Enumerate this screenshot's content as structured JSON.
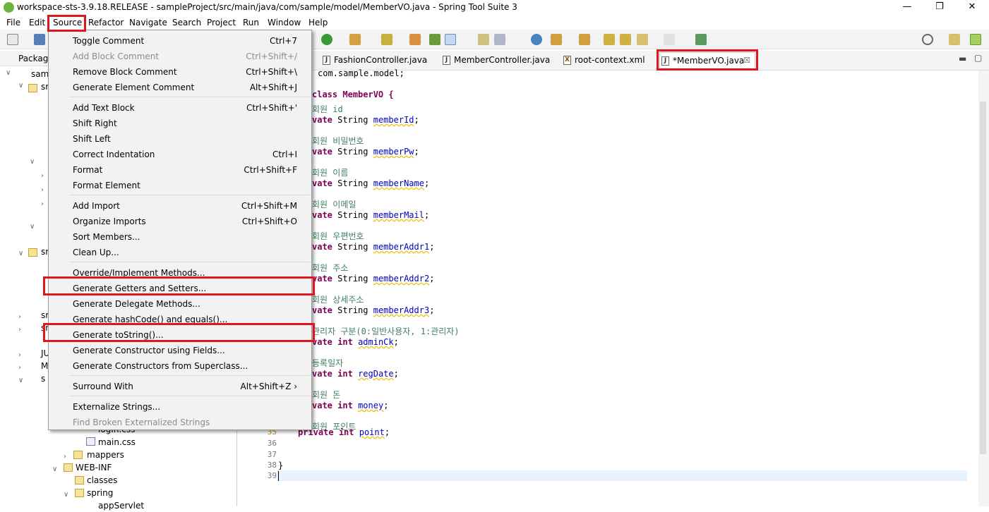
{
  "window": {
    "title": "workspace-sts-3.9.18.RELEASE - sampleProject/src/main/java/com/sample/model/MemberVO.java - Spring Tool Suite 3",
    "minimize": "—",
    "maximize": "❐",
    "close": "✕"
  },
  "menubar": {
    "items": [
      "File",
      "Edit",
      "Source",
      "Refactor",
      "Navigate",
      "Search",
      "Project",
      "Run",
      "Window",
      "Help"
    ]
  },
  "source_menu": {
    "items": [
      {
        "label": "Toggle Comment",
        "shortcut": "Ctrl+7"
      },
      {
        "label": "Add Block Comment",
        "shortcut": "Ctrl+Shift+/"
      },
      {
        "label": "Remove Block Comment",
        "shortcut": "Ctrl+Shift+\\"
      },
      {
        "label": "Generate Element Comment",
        "shortcut": "Alt+Shift+J"
      },
      {
        "label": "Add Text Block",
        "shortcut": "Ctrl+Shift+'"
      },
      {
        "label": "Shift Right",
        "shortcut": ""
      },
      {
        "label": "Shift Left",
        "shortcut": ""
      },
      {
        "label": "Correct Indentation",
        "shortcut": "Ctrl+I"
      },
      {
        "label": "Format",
        "shortcut": "Ctrl+Shift+F"
      },
      {
        "label": "Format Element",
        "shortcut": ""
      },
      {
        "label": "Add Import",
        "shortcut": "Ctrl+Shift+M"
      },
      {
        "label": "Organize Imports",
        "shortcut": "Ctrl+Shift+O"
      },
      {
        "label": "Sort Members...",
        "shortcut": ""
      },
      {
        "label": "Clean Up...",
        "shortcut": ""
      },
      {
        "label": "Override/Implement Methods...",
        "shortcut": ""
      },
      {
        "label": "Generate Getters and Setters...",
        "shortcut": ""
      },
      {
        "label": "Generate Delegate Methods...",
        "shortcut": ""
      },
      {
        "label": "Generate hashCode() and equals()...",
        "shortcut": ""
      },
      {
        "label": "Generate toString()...",
        "shortcut": ""
      },
      {
        "label": "Generate Constructor using Fields...",
        "shortcut": ""
      },
      {
        "label": "Generate Constructors from Superclass...",
        "shortcut": ""
      },
      {
        "label": "Surround With",
        "shortcut": "Alt+Shift+Z ›"
      },
      {
        "label": "Externalize Strings...",
        "shortcut": ""
      },
      {
        "label": "Find Broken Externalized Strings",
        "shortcut": ""
      }
    ]
  },
  "package_explorer": {
    "header": "Package",
    "project": "samp",
    "src_fragment": "sr",
    "items": [
      "sr",
      "sr",
      "sr",
      "sr",
      "JU",
      "M",
      "s"
    ],
    "files": [
      "logIn.css",
      "main.css",
      "mappers",
      "WEB-INF",
      "classes",
      "spring",
      "appServlet"
    ]
  },
  "editor_tabs": [
    {
      "label": "FashionController.java"
    },
    {
      "label": "MemberController.java"
    },
    {
      "label": "root-context.xml"
    },
    {
      "label": "*MemberVO.java"
    }
  ],
  "code": {
    "package_line": "com.sample.model;",
    "class_line": "class MemberVO {",
    "lines": [
      {
        "comment": "회원 id",
        "type": "String",
        "field": "memberId"
      },
      {
        "comment": "회원 비밀번호",
        "type": "String",
        "field": "memberPw"
      },
      {
        "comment": "회원 이름",
        "type": "String",
        "field": "memberName"
      },
      {
        "comment": "회원 이메일",
        "type": "String",
        "field": "memberMail"
      },
      {
        "comment": "회원 우편번호",
        "type": "String",
        "field": "memberAddr1"
      },
      {
        "comment": "회원 주소",
        "type": "String",
        "field": "memberAddr2"
      },
      {
        "comment": "회원 상세주소",
        "type": "String",
        "field": "memberAddr3"
      },
      {
        "comment": "관리자 구분(0:일반사용자, 1:관리자)",
        "type": "int",
        "field": "adminCk"
      },
      {
        "comment": "등록일자",
        "type": "int",
        "field": "regDate"
      },
      {
        "comment": "회원 돈",
        "type": "int",
        "field": "money"
      },
      {
        "comment": "회원 포인트",
        "type": "int",
        "field": "point"
      }
    ],
    "line_numbers": [
      "35",
      "36",
      "37",
      "38",
      "39"
    ],
    "closing": "}",
    "private_kw": "private",
    "private_partial": "vate",
    "comment_prefix": "//"
  },
  "colors": {
    "highlight": "#e0161e",
    "keyword": "#7f0055",
    "comment": "#3f7f5f",
    "field": "#0000c0"
  }
}
